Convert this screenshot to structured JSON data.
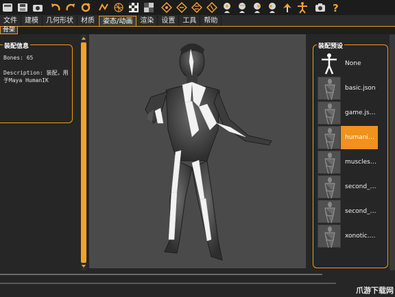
{
  "toolbar": {
    "icons": [
      "undo-stack-icon",
      "save-icon",
      "screenshot-icon",
      "undo-icon",
      "redo-icon",
      "reset-icon",
      "smooth-icon",
      "wireframe-icon",
      "texture-icon",
      "background-icon",
      "front-view-icon",
      "back-view-icon",
      "left-view-icon",
      "right-view-icon",
      "top-view-icon",
      "bottom-view-icon",
      "reset-camera-icon",
      "symmetry-icon",
      "pose-icon",
      "snapshot-icon",
      "help-icon"
    ]
  },
  "menu": {
    "tabs": [
      "文件",
      "建模",
      "几何形状",
      "材质",
      "姿态/动画",
      "渲染",
      "设置",
      "工具",
      "帮助"
    ],
    "active": "姿态/动画"
  },
  "subtab": {
    "label": "骨架"
  },
  "left": {
    "title": "装配信息",
    "bones": "Bones: 65",
    "description_1": "Description: 装配，用",
    "description_2": "于Maya HumanIK"
  },
  "right": {
    "title": "装配预设",
    "presets": [
      {
        "label": "None",
        "selected": false
      },
      {
        "label": "basic.json",
        "selected": false
      },
      {
        "label": "game.json",
        "selected": false
      },
      {
        "label": "humanik.json",
        "selected": true
      },
      {
        "label": "muscles.json",
        "selected": false
      },
      {
        "label": "second_life.json",
        "selected": false
      },
      {
        "label": "second_life_bento.json",
        "selected": false
      },
      {
        "label": "xonotic.json",
        "selected": false
      }
    ]
  },
  "watermark": "爪游下载网",
  "colors": {
    "accent": "#f59a1b",
    "viewport_bg": "#4a4a4a",
    "panel_bg": "#262626"
  }
}
